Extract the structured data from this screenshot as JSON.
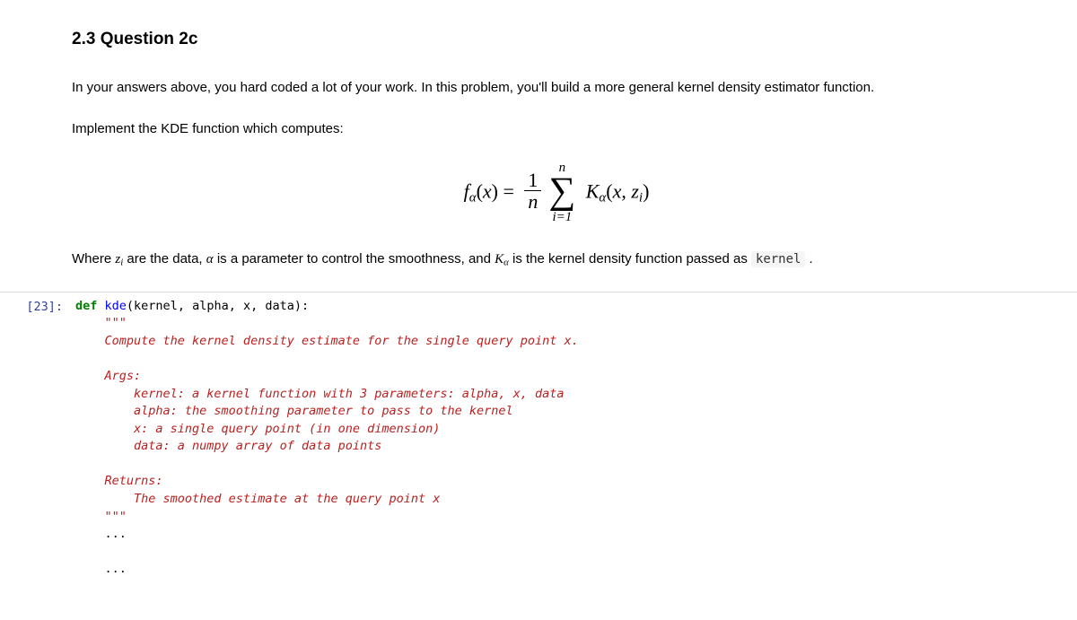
{
  "section": {
    "heading": "2.3  Question 2c",
    "para1": "In your answers above, you hard coded a lot of your work. In this problem, you'll build a more general kernel density estimator function.",
    "para2": "Implement the KDE function which computes:",
    "para3_prefix": "Where ",
    "para3_mid1": " are the data, ",
    "para3_mid2": " is a parameter to control the smoothness, and ",
    "para3_mid3": " is the kernel density function passed as ",
    "para3_suffix": " .",
    "kernel_code": "kernel"
  },
  "formula": {
    "f": "f",
    "alpha": "α",
    "x": "x",
    "eq": " = ",
    "one": "1",
    "n": "n",
    "sum_upper": "n",
    "sum_lower": "i=1",
    "K": "K",
    "zi_z": "z",
    "zi_i": "i",
    "open": "(",
    "close": ")",
    "comma": ", "
  },
  "inline": {
    "zi_z": "z",
    "zi_i": "i",
    "alpha": "α",
    "K": "K",
    "K_alpha": "α"
  },
  "cell": {
    "prompt": "[23]:",
    "def_kw": "def",
    "fn_name": "kde",
    "signature": "(kernel, alpha, x, data):",
    "doc_open": "    \"\"\"",
    "doc_l1": "    Compute the kernel density estimate for the single query point x.",
    "doc_blank": "",
    "doc_args": "    Args:",
    "doc_a1": "        kernel: a kernel function with 3 parameters: alpha, x, data",
    "doc_a2": "        alpha: the smoothing parameter to pass to the kernel",
    "doc_a3": "        x: a single query point (in one dimension)",
    "doc_a4": "        data: a numpy array of data points",
    "doc_ret": "    Returns:",
    "doc_r1": "        The smoothed estimate at the query point x",
    "doc_close": "    \"\"\"",
    "ell1": "    ...",
    "ell2": "    ..."
  }
}
